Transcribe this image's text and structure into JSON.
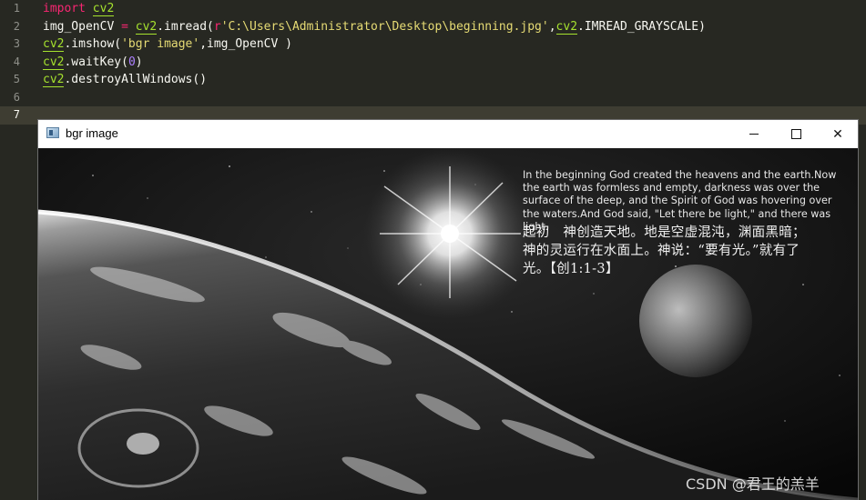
{
  "editor": {
    "lines": [
      {
        "num": "1",
        "parts": [
          {
            "t": "import",
            "c": "kw"
          },
          {
            "t": " "
          },
          {
            "t": "cv2",
            "c": "und"
          }
        ]
      },
      {
        "num": "2",
        "parts": [
          {
            "t": "img_OpenCV "
          },
          {
            "t": "=",
            "c": "kw"
          },
          {
            "t": " "
          },
          {
            "t": "cv2",
            "c": "und"
          },
          {
            "t": ".imread("
          },
          {
            "t": "r",
            "c": "kw"
          },
          {
            "t": "'C:\\Users\\Administrator\\Desktop\\beginning.jpg'",
            "c": "str"
          },
          {
            "t": ","
          },
          {
            "t": "cv2",
            "c": "und"
          },
          {
            "t": ".IMREAD_GRAYSCALE)"
          }
        ]
      },
      {
        "num": "3",
        "parts": [
          {
            "t": "cv2",
            "c": "und"
          },
          {
            "t": ".imshow("
          },
          {
            "t": "'bgr image'",
            "c": "str"
          },
          {
            "t": ",img_OpenCV )"
          }
        ]
      },
      {
        "num": "4",
        "parts": [
          {
            "t": "cv2",
            "c": "und"
          },
          {
            "t": ".waitKey("
          },
          {
            "t": "0",
            "c": "num"
          },
          {
            "t": ")"
          }
        ]
      },
      {
        "num": "5",
        "parts": [
          {
            "t": "cv2",
            "c": "und"
          },
          {
            "t": ".destroyAllWindows()"
          }
        ]
      },
      {
        "num": "6",
        "parts": []
      },
      {
        "num": "7",
        "parts": [],
        "current": true
      }
    ]
  },
  "window": {
    "title": "bgr image",
    "minimize_label": "—",
    "close_label": "✕"
  },
  "image": {
    "verse_en": "In the beginning God created the heavens and the earth.Now the earth was formless and empty, darkness was over the surface of the deep, and the Spirit of God was hovering over the waters.And God said, \"Let there be light,\" and there was light.",
    "verse_zh": "起初　神创造天地。地是空虚混沌，渊面黑暗；　神的灵运行在水面上。神说：“要有光。”就有了光。【创1:1-3】"
  },
  "watermark": "CSDN @君王的羔羊",
  "colors": {
    "editor_bg": "#272822",
    "current_line": "#3e3d32",
    "keyword": "#f92672",
    "string": "#e6db74",
    "number": "#ae81ff",
    "module": "#a6e22e"
  }
}
